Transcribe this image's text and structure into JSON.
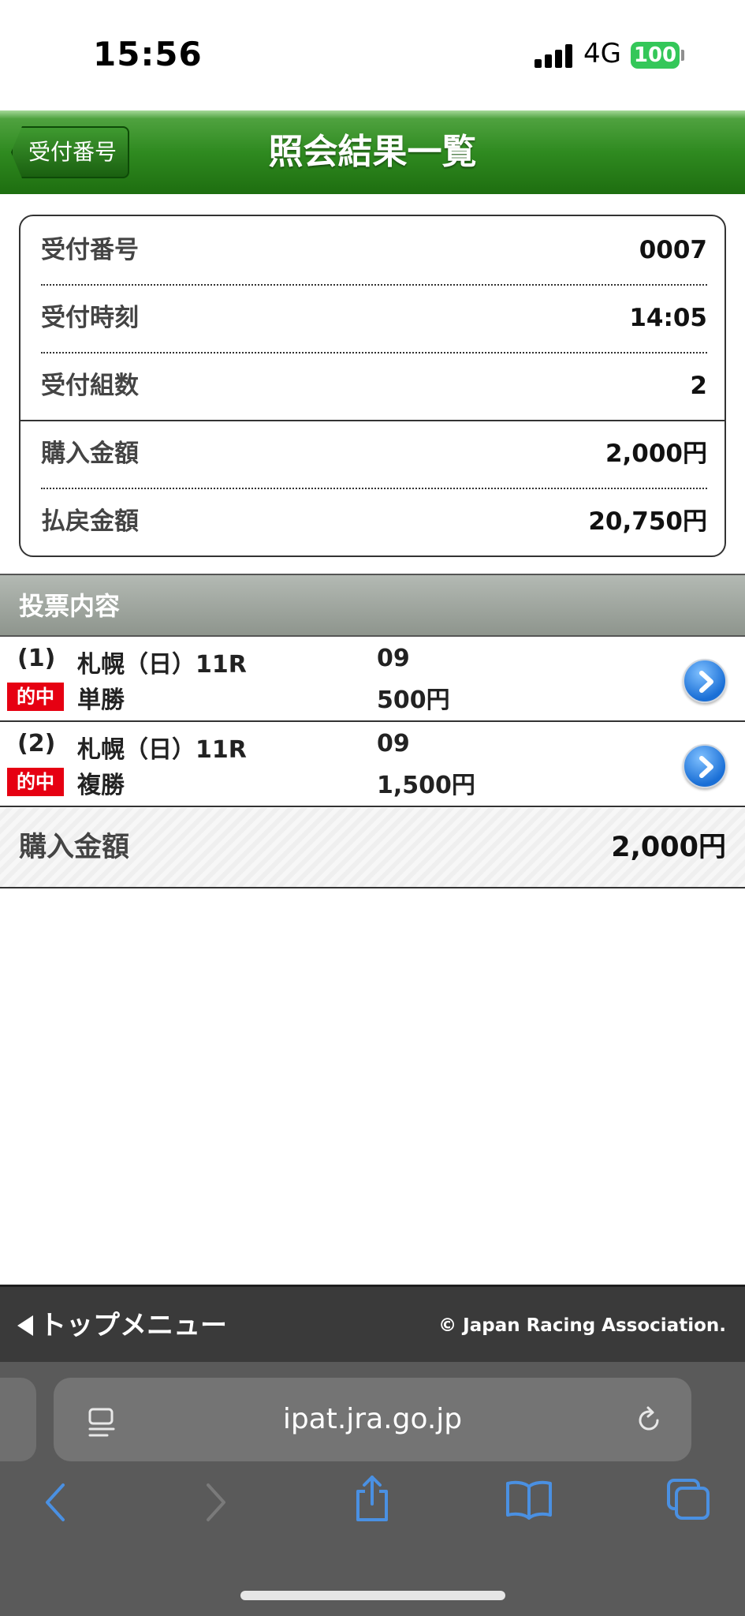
{
  "status_bar": {
    "time": "15:56",
    "network": "4G",
    "battery": "100"
  },
  "header": {
    "back_label": "受付番号",
    "title": "照会結果一覧"
  },
  "summary": {
    "rows": [
      {
        "label": "受付番号",
        "value": "0007"
      },
      {
        "label": "受付時刻",
        "value": "14:05"
      },
      {
        "label": "受付組数",
        "value": "2"
      },
      {
        "label": "購入金額",
        "value": "2,000円"
      },
      {
        "label": "払戻金額",
        "value": "20,750円"
      }
    ]
  },
  "section": {
    "title": "投票内容"
  },
  "bets": [
    {
      "number": "(1)",
      "race": "札幌（日）11R",
      "horse": "09",
      "badge": "的中",
      "type": "単勝",
      "amount": "500円"
    },
    {
      "number": "(2)",
      "race": "札幌（日）11R",
      "horse": "09",
      "badge": "的中",
      "type": "複勝",
      "amount": "1,500円"
    }
  ],
  "total": {
    "label": "購入金額",
    "value": "2,000円"
  },
  "footer": {
    "top_menu": "トップメニュー",
    "copyright": "© Japan Racing Association."
  },
  "browser": {
    "url": "ipat.jra.go.jp"
  },
  "colors": {
    "header_green": "#2f8a20",
    "badge_red": "#e60012",
    "arrow_blue": "#1a6fd6",
    "battery_green": "#34c759",
    "safari_blue": "#4a90e2"
  }
}
